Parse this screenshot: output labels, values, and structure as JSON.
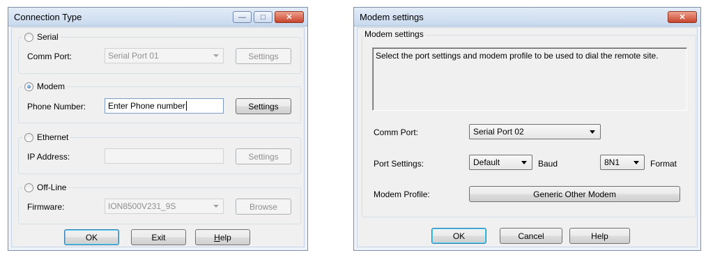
{
  "connection_dialog": {
    "title": "Connection Type",
    "minimize_glyph": "—",
    "maximize_glyph": "□",
    "close_glyph": "✕",
    "serial": {
      "label": "Serial",
      "checked": false,
      "comm_port_label": "Comm Port:",
      "comm_port_value": "Serial Port 01",
      "settings_label": "Settings"
    },
    "modem": {
      "label": "Modem",
      "checked": true,
      "phone_label": "Phone Number:",
      "phone_value": "Enter Phone number",
      "settings_label": "Settings"
    },
    "ethernet": {
      "label": "Ethernet",
      "checked": false,
      "ip_label": "IP Address:",
      "ip_value": "",
      "settings_label": "Settings"
    },
    "offline": {
      "label": "Off-Line",
      "checked": false,
      "firmware_label": "Firmware:",
      "firmware_value": "ION8500V231_9S",
      "browse_label": "Browse"
    },
    "buttons": {
      "ok": "OK",
      "exit": "Exit",
      "help_first": "H",
      "help_rest": "elp"
    }
  },
  "modem_dialog": {
    "title": "Modem settings",
    "close_glyph": "✕",
    "group_label": "Modem settings",
    "info_text": "Select the port settings and modem profile to be used to dial the remote site.",
    "comm_port_label": "Comm Port:",
    "comm_port_value": "Serial Port 02",
    "port_settings_label": "Port Settings:",
    "baud_value": "Default",
    "baud_label": "Baud",
    "format_value": "8N1",
    "format_label": "Format",
    "modem_profile_label": "Modem Profile:",
    "modem_profile_value": "Generic Other Modem",
    "buttons": {
      "ok": "OK",
      "cancel": "Cancel",
      "help": "Help"
    }
  }
}
